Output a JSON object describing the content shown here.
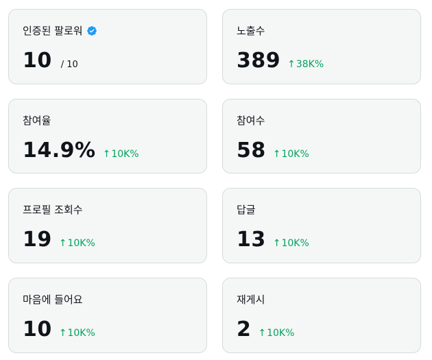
{
  "accent_color": "#1d9bf0",
  "delta_color": "#00a35c",
  "cards": [
    {
      "title": "인증된 팔로워",
      "value": "10",
      "sub": "/ 10",
      "icon": "verified-badge-icon"
    },
    {
      "title": "노출수",
      "value": "389",
      "delta": "38K%"
    },
    {
      "title": "참여율",
      "value": "14.9%",
      "delta": "10K%"
    },
    {
      "title": "참여수",
      "value": "58",
      "delta": "10K%"
    },
    {
      "title": "프로필 조회수",
      "value": "19",
      "delta": "10K%"
    },
    {
      "title": "답글",
      "value": "13",
      "delta": "10K%"
    },
    {
      "title": "마음에 들어요",
      "value": "10",
      "delta": "10K%"
    },
    {
      "title": "재게시",
      "value": "2",
      "delta": "10K%"
    }
  ]
}
